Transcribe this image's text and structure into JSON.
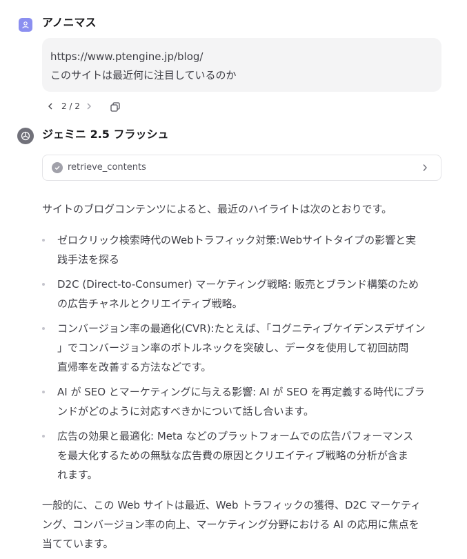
{
  "user": {
    "name": "アノニマス",
    "message_lines": [
      "https://www.ptengine.jp/blog/",
      "このサイトは最近何に注目しているのか"
    ]
  },
  "pager": {
    "text": "2 / 2"
  },
  "model": {
    "name": "ジェミニ 2.5 フラッシュ",
    "tool_call": {
      "label": "retrieve_contents"
    },
    "intro": "サイトのブログコンテンツによると、最近のハイライトは次のとおりです。",
    "bullets": [
      {
        "lines": [
          "ゼロクリック検索時代のWebトラフィック対策:Webサイトタイプの影響と実",
          "践手法を探る"
        ]
      },
      {
        "lines": [
          "D2C (Direct-to-Consumer) マーケティング戦略: 販売とブランド構築のため",
          "の広告チャネルとクリエイティブ戦略。"
        ]
      },
      {
        "lines": [
          "コンバージョン率の最適化(CVR):たとえば、「コグニティブケイデンスデザイン",
          "」でコンバージョン率のボトルネックを突破し、データを使用して初回訪問",
          "直帰率を改善する方法などです。"
        ]
      },
      {
        "lines": [
          "AI が SEO とマーケティングに与える影響: AI が SEO を再定義する時代にブラ",
          "ンドがどのように対応すべきかについて話し合います。"
        ]
      },
      {
        "lines": [
          "広告の効果と最適化: Meta などのプラットフォームでの広告パフォーマンス",
          "を最大化するための無駄な広告費の原因とクリエイティブ戦略の分析が含ま",
          "れます。"
        ]
      }
    ],
    "outro_lines": [
      "一般的に、この Web サイトは最近、Web トラフィックの獲得、D2C マーケティ",
      "ング、コンバージョン率の向上、マーケティング分野における AI の応用に焦点を",
      "当てています。"
    ]
  }
}
